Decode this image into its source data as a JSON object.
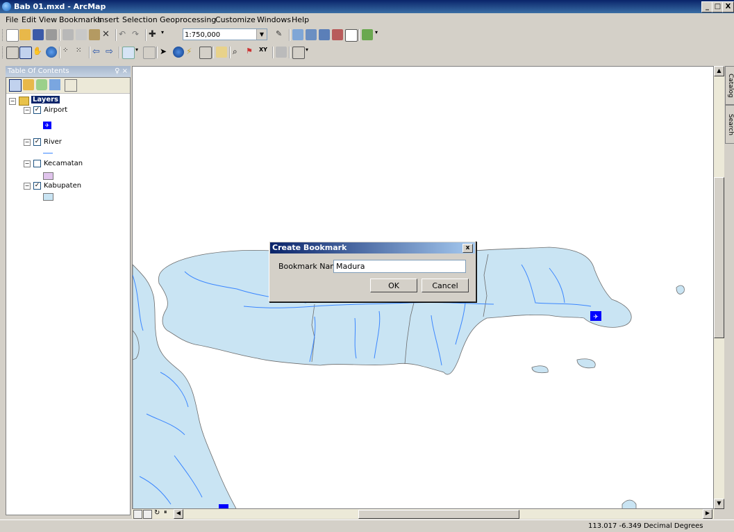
{
  "window": {
    "title": "Bab 01.mxd - ArcMap",
    "min_label": "_",
    "max_label": "□",
    "close_label": "X"
  },
  "menu": [
    "File",
    "Edit",
    "View",
    "Bookmarks",
    "Insert",
    "Selection",
    "Geoprocessing",
    "Customize",
    "Windows",
    "Help"
  ],
  "toolbar": {
    "scale": "1:750,000"
  },
  "toc": {
    "title": "Table Of Contents",
    "pin": "♀ ×",
    "root_label": "Layers",
    "layers": [
      {
        "name": "Airport",
        "checked": true
      },
      {
        "name": "River",
        "checked": true
      },
      {
        "name": "Kecamatan",
        "checked": false
      },
      {
        "name": "Kabupaten",
        "checked": true
      }
    ]
  },
  "side_tabs": [
    "Catalog",
    "Search"
  ],
  "dialog": {
    "title": "Create Bookmark",
    "name_label": "Bookmark Name:",
    "name_value": "Madura",
    "ok_label": "OK",
    "cancel_label": "Cancel",
    "close_label": "x"
  },
  "status": {
    "coordinates": "113.017  -6.349 Decimal Degrees"
  },
  "colors": {
    "land": "#c9e4f3",
    "river": "#3a86ff",
    "boundary": "#6b6b6b",
    "airport": "#0000ff",
    "kecamatan_fill": "#e0c4ec",
    "kabupaten_fill": "#c9e4f3"
  }
}
